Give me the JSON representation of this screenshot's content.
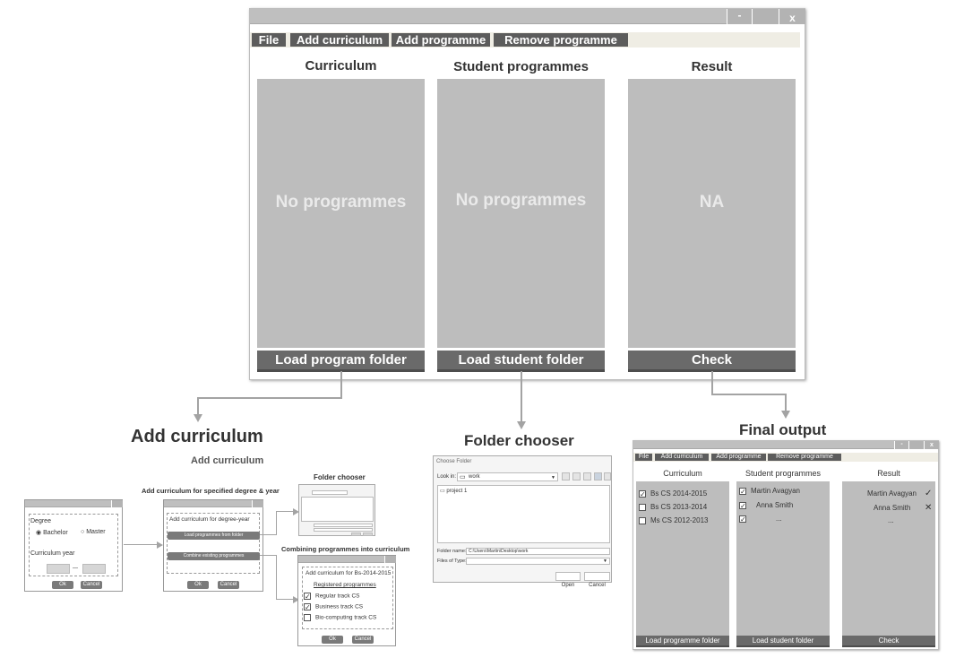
{
  "main": {
    "window_buttons": {
      "minimize": "-",
      "close": "x"
    },
    "menu": [
      "File",
      "Add curriculum",
      "Add programme",
      "Remove programme"
    ],
    "columns": [
      {
        "title": "Curriculum",
        "placeholder": "No programmes",
        "button": "Load program folder"
      },
      {
        "title": "Student programmes",
        "placeholder": "No programmes",
        "button": "Load student folder"
      },
      {
        "title": "Result",
        "placeholder": "NA",
        "button": "Check"
      }
    ]
  },
  "sections": {
    "add_curriculum": "Add curriculum",
    "folder_chooser": "Folder chooser",
    "final_output": "Final output"
  },
  "add_curriculum": {
    "subtitle": "Add curriculum",
    "dialog1": {
      "degree_label": "Degree",
      "options": [
        "Bachelor",
        "Master"
      ],
      "year_label": "Curriculum year",
      "year_sep": "—",
      "ok": "Ok",
      "cancel": "Cancel"
    },
    "dialog2": {
      "caption": "Add curriculum for specified degree & year",
      "title": "Add curriculum for degree-year",
      "load_btn": "Load programmes from folder",
      "combine_btn": "Combine existing programmes",
      "ok": "Ok",
      "cancel": "Cancel"
    },
    "mini_chooser_caption": "Folder chooser",
    "dialog3": {
      "caption": "Combining programmes into curriculum",
      "title": "Add curriculum for Bs-2014-2015",
      "registered": "Registered programmes",
      "items": [
        {
          "label": "Regular track CS",
          "checked": "✓"
        },
        {
          "label": "Business track CS",
          "checked": "✓"
        },
        {
          "label": "Bio-computing track CS",
          "checked": ""
        }
      ],
      "ok": "Ok",
      "cancel": "Cancel"
    }
  },
  "folder_chooser": {
    "window_title": "Choose Folder",
    "look_in_label": "Look in:",
    "look_in_value": "work",
    "items": [
      "project 1"
    ],
    "folder_name_label": "Folder name:",
    "folder_name_value": "C:\\Users\\Martin\\Desktop\\work",
    "files_type_label": "Files of Type:",
    "open": "Open",
    "cancel": "Cancel"
  },
  "final_output": {
    "menu": [
      "File",
      "Add curriculum",
      "Add programme",
      "Remove programme"
    ],
    "curriculum_title": "Curriculum",
    "curriculum_items": [
      {
        "label": "Bs  CS 2014-2015",
        "checked": "✓"
      },
      {
        "label": "Bs  CS 2013-2014",
        "checked": ""
      },
      {
        "label": "Ms  CS 2012-2013",
        "checked": ""
      }
    ],
    "students_title": "Student programmes",
    "student_items": [
      {
        "label": "Martin Avagyan",
        "checked": "✓"
      },
      {
        "label": "Anna Smith",
        "checked": "✓"
      },
      {
        "label": "...",
        "checked": "✓"
      }
    ],
    "result_title": "Result",
    "result_items": [
      {
        "label": "Martin Avagyan",
        "mark": "✓"
      },
      {
        "label": "Anna Smith",
        "mark": "✕"
      },
      {
        "label": "...",
        "mark": ""
      }
    ],
    "buttons": [
      "Load programme folder",
      "Load student folder",
      "Check"
    ]
  }
}
